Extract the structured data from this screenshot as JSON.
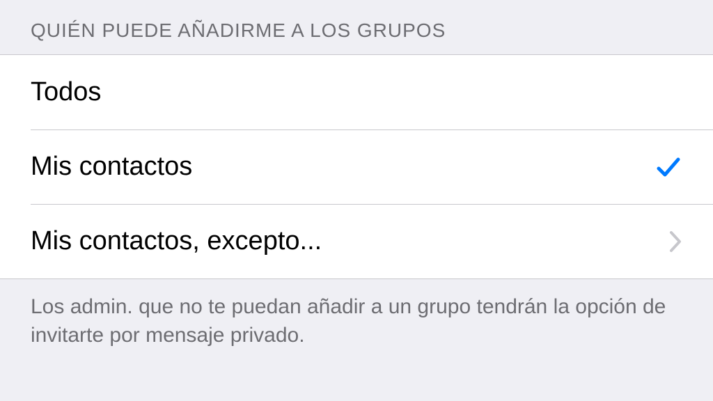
{
  "section": {
    "header": "Quién puede añadirme a los grupos",
    "footer": "Los admin. que no te puedan añadir a un grupo tendrán la opción de invitarte por mensaje privado.",
    "options": [
      {
        "label": "Todos",
        "selected": false,
        "hasChevron": false
      },
      {
        "label": "Mis contactos",
        "selected": true,
        "hasChevron": false
      },
      {
        "label": "Mis contactos, excepto...",
        "selected": false,
        "hasChevron": true
      }
    ]
  },
  "colors": {
    "accent": "#007aff",
    "chevron": "#c7c7cc"
  }
}
